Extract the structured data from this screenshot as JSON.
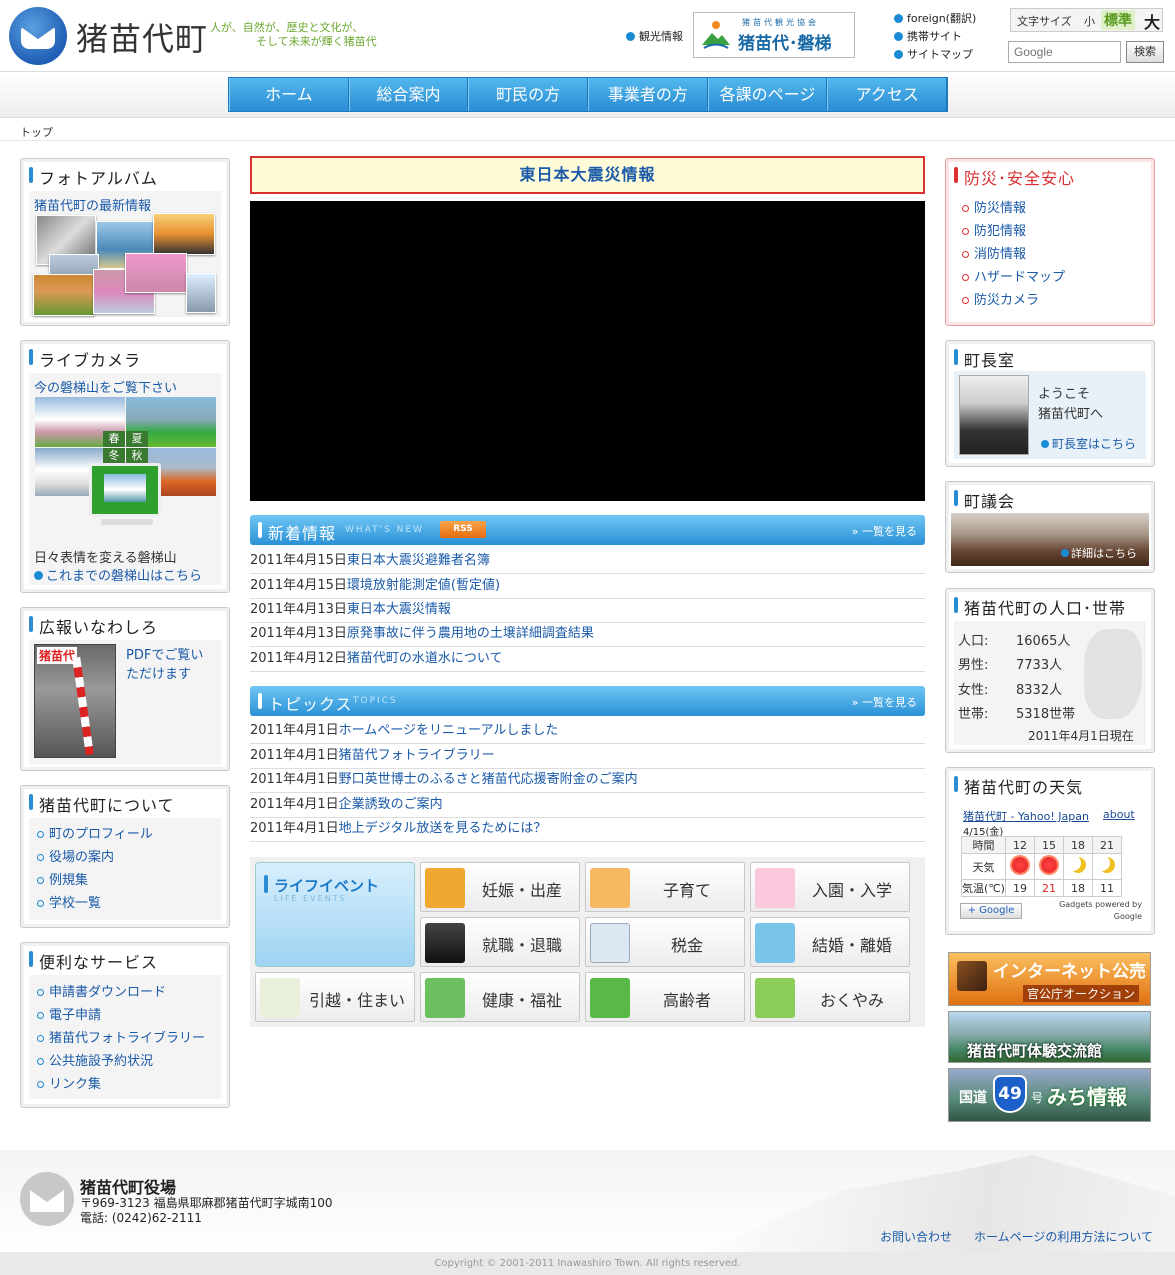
{
  "header": {
    "site_title": "猪苗代町",
    "tagline_line1": "人が、自然が、歴史と文化が、",
    "tagline_line2": "そして未来が輝く猪苗代",
    "kanko_link": "観光情報",
    "kanko_banner_assoc": "猪苗代観光協会",
    "kanko_banner_name": "猪苗代･磐梯",
    "foreign_link": "foreign(翻訳)",
    "mobile_link": "携帯サイト",
    "sitemap_link": "サイトマップ",
    "font_size_label": "文字サイズ",
    "font_small": "小",
    "font_standard": "標準",
    "font_large": "大",
    "search_placeholder": "Google",
    "search_button": "検索"
  },
  "nav": [
    "ホーム",
    "総合案内",
    "町民の方",
    "事業者の方",
    "各課のページ",
    "アクセス"
  ],
  "breadcrumb": "トップ",
  "left": {
    "photo_album": {
      "title": "フォトアルバム",
      "link": "猪苗代町の最新情報"
    },
    "live_camera": {
      "title": "ライブカメラ",
      "link": "今の磐梯山をご覧下さい",
      "season_spring": "春",
      "season_summer": "夏",
      "season_winter": "冬",
      "season_autumn": "秋",
      "caption": "日々表情を変える磐梯山",
      "archive_link": "これまでの磐梯山はこちら"
    },
    "koho": {
      "title": "広報いなわしろ",
      "pdf_line1": "PDFでご覧い",
      "pdf_line2": "ただけます",
      "cover_title": "猪苗代"
    },
    "about": {
      "title": "猪苗代町について",
      "items": [
        "町のプロフィール",
        "役場の案内",
        "例規集",
        "学校一覧"
      ]
    },
    "services": {
      "title": "便利なサービス",
      "items": [
        "申請書ダウンロード",
        "電子申請",
        "猪苗代フォトライブラリー",
        "公共施設予約状況",
        "リンク集"
      ]
    }
  },
  "center": {
    "quake_banner": "東日本大震災情報",
    "news": {
      "title": "新着情報",
      "subtitle": "WHAT'S NEW",
      "rss": "RSS",
      "more": "» 一覧を見る",
      "rows": [
        {
          "date": "2011年4月15日",
          "text": "東日本大震災避難者名簿"
        },
        {
          "date": "2011年4月15日",
          "text": "環境放射能測定値(暫定値)"
        },
        {
          "date": "2011年4月13日",
          "text": "東日本大震災情報"
        },
        {
          "date": "2011年4月13日",
          "text": "原発事故に伴う農用地の土壌詳細調査結果"
        },
        {
          "date": "2011年4月12日",
          "text": "猪苗代町の水道水について"
        }
      ]
    },
    "topics": {
      "title": "トピックス",
      "subtitle": "TOPICS",
      "more": "» 一覧を見る",
      "rows": [
        {
          "date": "2011年4月1日",
          "text": "ホームページをリニューアルしました"
        },
        {
          "date": "2011年4月1日",
          "text": "猪苗代フォトライブラリー"
        },
        {
          "date": "2011年4月1日",
          "text": "野口英世博士のふるさと猪苗代応援寄附金のご案内"
        },
        {
          "date": "2011年4月1日",
          "text": "企業誘致のご案内"
        },
        {
          "date": "2011年4月1日",
          "text": "地上デジタル放送を見るためには？"
        }
      ]
    },
    "life_events": {
      "title": "ライフイベント",
      "subtitle": "LIFE EVENTS",
      "items": [
        "妊娠・出産",
        "子育て",
        "入園・入学",
        "就職・退職",
        "税金",
        "結婚・離婚",
        "引越・住まい",
        "健康・福祉",
        "高齢者",
        "おくやみ"
      ]
    }
  },
  "right": {
    "safety": {
      "title": "防災･安全安心",
      "items": [
        "防災情報",
        "防犯情報",
        "消防情報",
        "ハザードマップ",
        "防災カメラ"
      ]
    },
    "mayor": {
      "title": "町長室",
      "greeting_line1": "ようこそ",
      "greeting_line2": "猪苗代町へ",
      "link": "町長室はこちら"
    },
    "council": {
      "title": "町議会",
      "link": "詳細はこちら"
    },
    "population": {
      "title": "猪苗代町の人口･世帯",
      "rows": [
        {
          "label": "人口:",
          "value": "16065人"
        },
        {
          "label": "男性:",
          "value": "7733人"
        },
        {
          "label": "女性:",
          "value": "8332人"
        },
        {
          "label": "世帯:",
          "value": "5318世帯"
        }
      ],
      "as_of": "2011年4月1日現在"
    },
    "weather": {
      "title": "猪苗代町の天気",
      "source": "猪苗代町 - Yahoo! Japan",
      "about": "about",
      "date": "4/15(金)",
      "time_label": "時間",
      "times": [
        "12",
        "15",
        "18",
        "21"
      ],
      "weather_label": "天気",
      "temp_label": "気温(℃)",
      "temps": [
        "19",
        "21",
        "18",
        "11"
      ],
      "google_btn": "+ Google",
      "powered_line1": "Gadgets powered by",
      "powered_line2": "Google"
    },
    "banners": {
      "auction_main": "インターネット公売",
      "auction_sub": "官公庁オークション",
      "exchange": "猪苗代町体験交流館",
      "road_pre": "国道",
      "road_num": "49",
      "road_mid": "号",
      "road_post": "みち情報"
    }
  },
  "footer": {
    "office": "猪苗代町役場",
    "address": "〒969-3123 福島県耶麻郡猪苗代町字城南100",
    "phone": "電話: (0242)62-2111",
    "contact_link": "お問い合わせ",
    "usage_link": "ホームページの利用方法について",
    "copyright": "Copyright © 2001-2011 Inawashiro Town. All rights reserved."
  },
  "colors": {
    "accent_blue": "#2a8cd3",
    "alert_red": "#d93030",
    "link": "#1a5aa8",
    "tagline_green": "#6aa82e"
  }
}
